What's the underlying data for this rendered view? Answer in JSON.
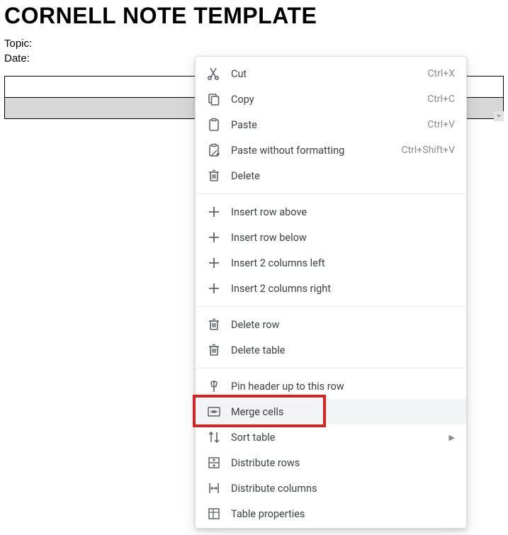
{
  "page": {
    "title": "CORNELL NOTE TEMPLATE",
    "topic_label": "Topic:",
    "date_label": "Date:"
  },
  "menu": {
    "sections": [
      [
        {
          "icon": "cut",
          "label": "Cut",
          "shortcut": "Ctrl+X"
        },
        {
          "icon": "copy",
          "label": "Copy",
          "shortcut": "Ctrl+C"
        },
        {
          "icon": "paste",
          "label": "Paste",
          "shortcut": "Ctrl+V"
        },
        {
          "icon": "paste-no-format",
          "label": "Paste without formatting",
          "shortcut": "Ctrl+Shift+V"
        },
        {
          "icon": "delete",
          "label": "Delete"
        }
      ],
      [
        {
          "icon": "plus",
          "label": "Insert row above"
        },
        {
          "icon": "plus",
          "label": "Insert row below"
        },
        {
          "icon": "plus",
          "label": "Insert 2 columns left"
        },
        {
          "icon": "plus",
          "label": "Insert 2 columns right"
        }
      ],
      [
        {
          "icon": "delete",
          "label": "Delete row"
        },
        {
          "icon": "delete",
          "label": "Delete table"
        }
      ],
      [
        {
          "icon": "pin",
          "label": "Pin header up to this row"
        },
        {
          "icon": "merge",
          "label": "Merge cells",
          "hover": true,
          "highlight": true
        },
        {
          "icon": "sort",
          "label": "Sort table",
          "submenu": true
        },
        {
          "icon": "dist-rows",
          "label": "Distribute rows"
        },
        {
          "icon": "dist-cols",
          "label": "Distribute columns"
        },
        {
          "icon": "table-props",
          "label": "Table properties"
        }
      ]
    ]
  }
}
